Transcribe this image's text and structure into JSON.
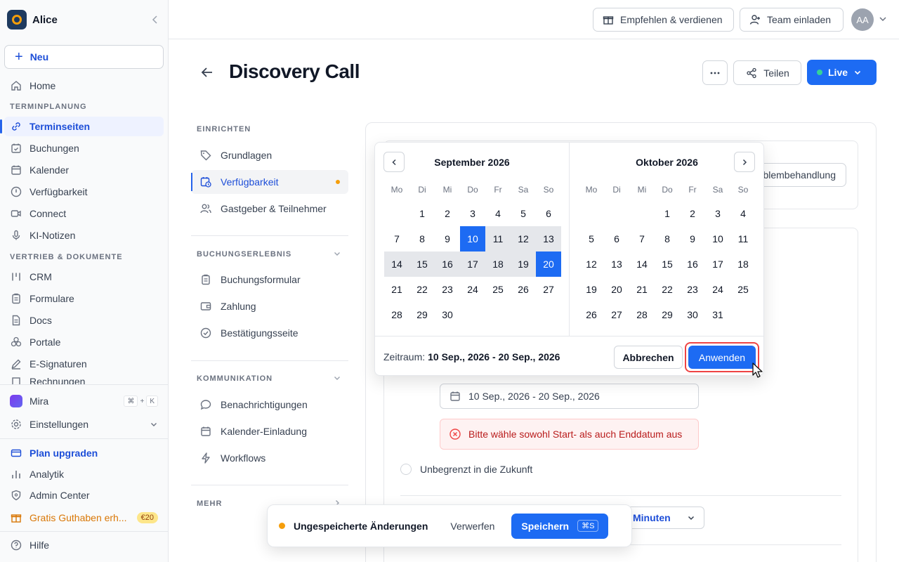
{
  "workspace": {
    "name": "Alice"
  },
  "sidebar": {
    "new_label": "Neu",
    "home": "Home",
    "section_scheduling": "TERMINPLANUNG",
    "scheduling_items": [
      "Terminseiten",
      "Buchungen",
      "Kalender",
      "Verfügbarkeit",
      "Connect",
      "KI-Notizen"
    ],
    "section_sales": "VERTRIEB & DOKUMENTE",
    "sales_items": [
      "CRM",
      "Formulare",
      "Docs",
      "Portale",
      "E-Signaturen",
      "Rechnungen"
    ],
    "mira": "Mira",
    "mira_shortcut": [
      "⌘",
      "+",
      "K"
    ],
    "settings": "Einstellungen",
    "plan_upgrade": "Plan upgraden",
    "analytics": "Analytik",
    "admin_center": "Admin Center",
    "credit": "Gratis Guthaben erh...",
    "credit_badge": "€20",
    "help": "Hilfe"
  },
  "topbar": {
    "refer": "Empfehlen & verdienen",
    "invite": "Team einladen",
    "avatar_initials": "AA"
  },
  "page": {
    "title": "Discovery Call",
    "share": "Teilen",
    "live": "Live"
  },
  "settings_nav": {
    "section_setup": "EINRICHTEN",
    "setup_items": [
      "Grundlagen",
      "Verfügbarkeit",
      "Gastgeber & Teilnehmer"
    ],
    "section_booking": "BUCHUNGSERLEBNIS",
    "booking_items": [
      "Buchungsformular",
      "Zahlung",
      "Bestätigungsseite"
    ],
    "section_comm": "KOMMUNIKATION",
    "comm_items": [
      "Benachrichtigungen",
      "Kalender-Einladung",
      "Workflows"
    ],
    "section_more": "MEHR"
  },
  "content": {
    "troubleshoot": "Problembehandlung",
    "date_range_value": "10 Sep., 2026 - 20 Sep., 2026",
    "error_text": "Bitte wähle sowohl Start- als auch Enddatum aus",
    "unlimited_label": "Unbegrenzt in die Zukunft",
    "minutes_label": "Minuten"
  },
  "datepicker": {
    "weekdays": [
      "Mo",
      "Di",
      "Mi",
      "Do",
      "Fr",
      "Sa",
      "So"
    ],
    "left_month": "September 2026",
    "right_month": "Oktober 2026",
    "left_weeks": [
      [
        "",
        "1",
        "2",
        "3",
        "4",
        "5",
        "6"
      ],
      [
        "7",
        "8",
        "9",
        "10",
        "11",
        "12",
        "13"
      ],
      [
        "14",
        "15",
        "16",
        "17",
        "18",
        "19",
        "20"
      ],
      [
        "21",
        "22",
        "23",
        "24",
        "25",
        "26",
        "27"
      ],
      [
        "28",
        "29",
        "30",
        "",
        "",
        "",
        ""
      ]
    ],
    "right_weeks": [
      [
        "",
        "",
        "",
        "1",
        "2",
        "3",
        "4"
      ],
      [
        "5",
        "6",
        "7",
        "8",
        "9",
        "10",
        "11"
      ],
      [
        "12",
        "13",
        "14",
        "15",
        "16",
        "17",
        "18"
      ],
      [
        "19",
        "20",
        "21",
        "22",
        "23",
        "24",
        "25"
      ],
      [
        "26",
        "27",
        "28",
        "29",
        "30",
        "31",
        ""
      ]
    ],
    "range_start": 10,
    "range_end": 20,
    "range_label": "Zeitraum:",
    "range_value": "10 Sep., 2026 - 20 Sep., 2026",
    "cancel": "Abbrechen",
    "apply": "Anwenden"
  },
  "unsaved_bar": {
    "text": "Ungespeicherte Änderungen",
    "discard": "Verwerfen",
    "save": "Speichern",
    "save_shortcut": "⌘S"
  },
  "colors": {
    "accent": "#1d6bf3",
    "error": "#b91c1c",
    "warning": "#f59e0b"
  }
}
